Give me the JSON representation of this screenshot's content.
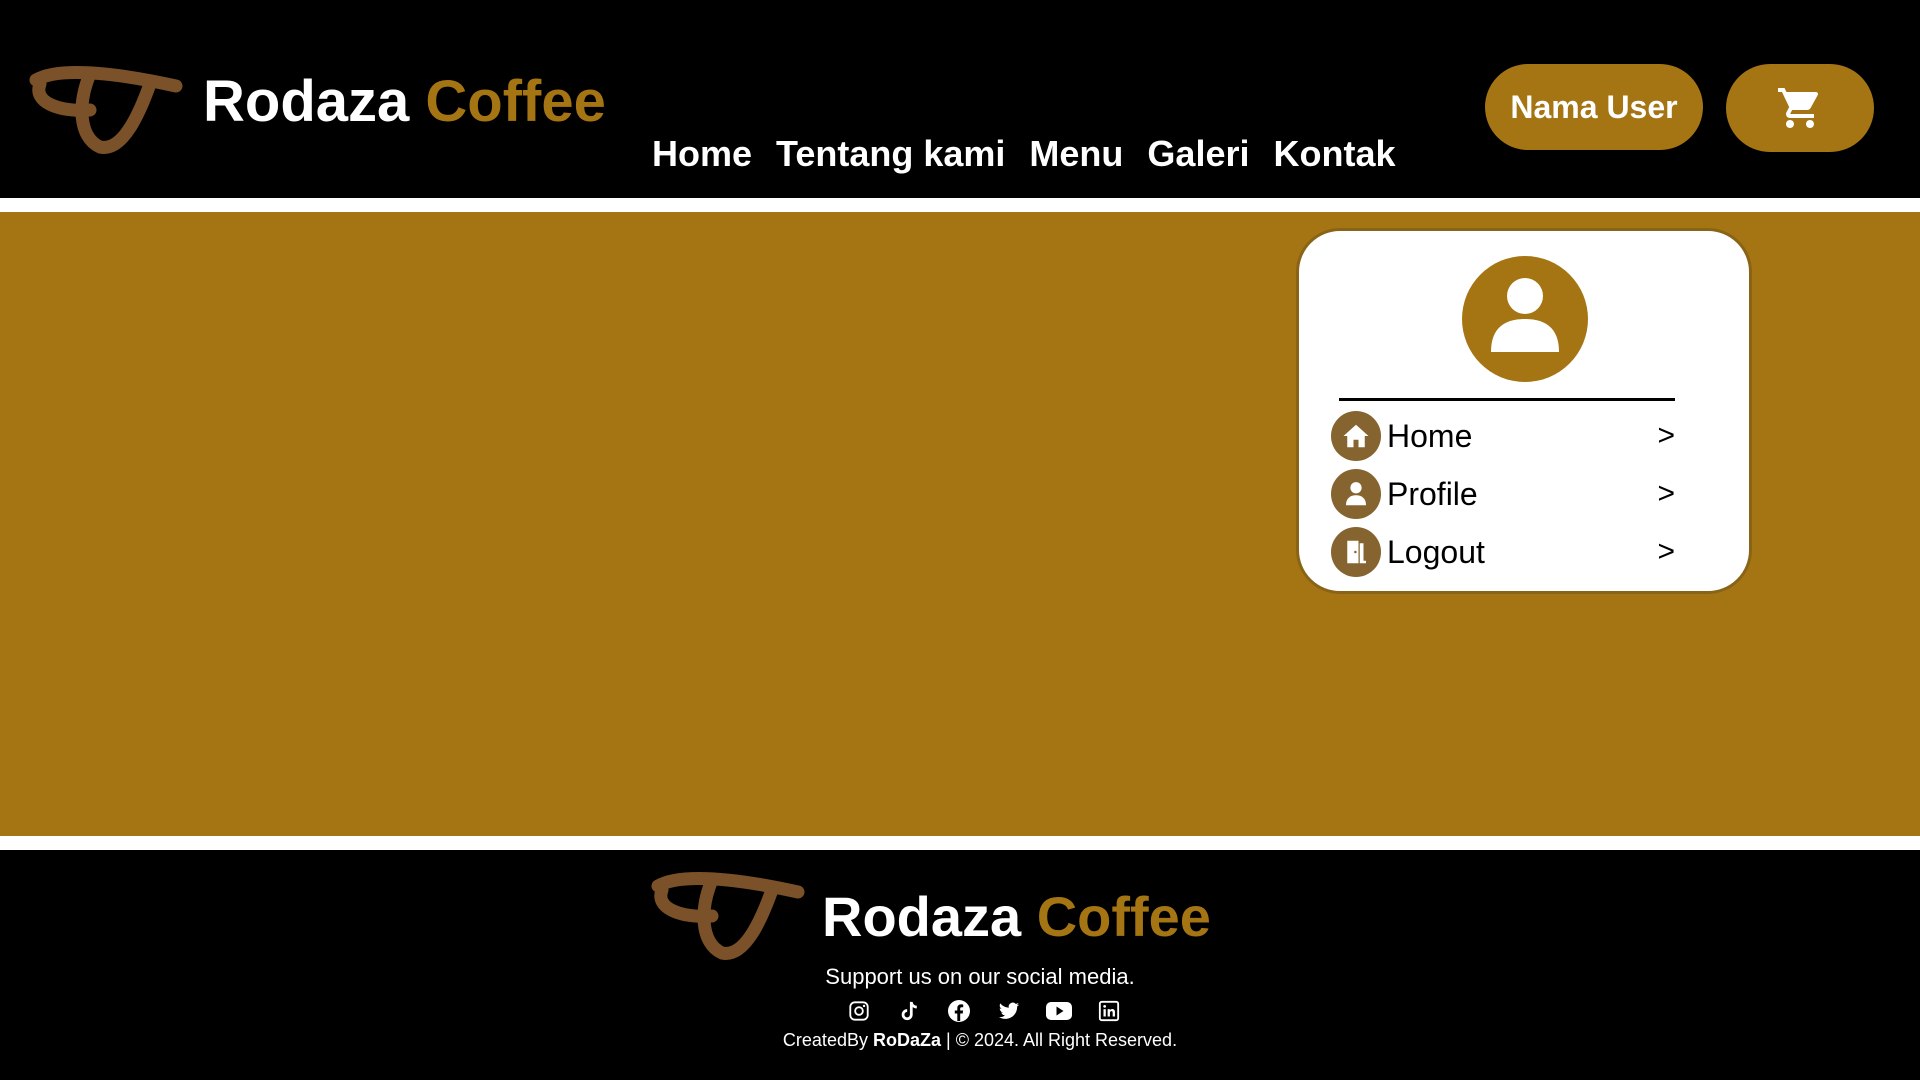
{
  "header": {
    "brand_name": "Rodaza",
    "brand_accent": "Coffee",
    "nav": [
      "Home",
      "Tentang kami",
      "Menu",
      "Galeri",
      "Kontak"
    ],
    "user_button": "Nama User",
    "cart_icon": "cart-icon"
  },
  "dropdown": {
    "avatar_icon": "user-icon",
    "items": [
      {
        "label": "Home",
        "icon": "home-icon",
        "chevron": ">"
      },
      {
        "label": "Profile",
        "icon": "user-icon",
        "chevron": ">"
      },
      {
        "label": "Logout",
        "icon": "door-icon",
        "chevron": ">"
      }
    ]
  },
  "footer": {
    "brand_name": "Rodaza",
    "brand_accent": "Coffee",
    "support_text": "Support us on our social media.",
    "social_icons": [
      "instagram-icon",
      "tiktok-icon",
      "facebook-icon",
      "twitter-icon",
      "youtube-icon",
      "linkedin-icon"
    ],
    "copyright_prefix": "CreatedBy",
    "copyright_name": "RoDaZa",
    "copyright_suffix": "| © 2024. All Right Reserved."
  },
  "colors": {
    "accent": "#a57514",
    "background": "#000000",
    "icon_brown": "#856430"
  }
}
